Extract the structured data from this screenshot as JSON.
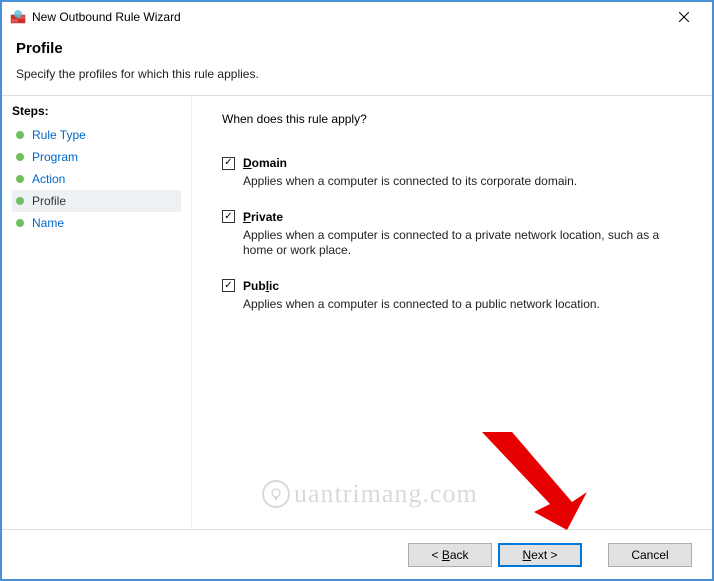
{
  "titlebar": {
    "title": "New Outbound Rule Wizard"
  },
  "header": {
    "title": "Profile",
    "subtitle": "Specify the profiles for which this rule applies."
  },
  "sidebar": {
    "label": "Steps:",
    "items": [
      {
        "label": "Rule Type",
        "current": false
      },
      {
        "label": "Program",
        "current": false
      },
      {
        "label": "Action",
        "current": false
      },
      {
        "label": "Profile",
        "current": true
      },
      {
        "label": "Name",
        "current": false
      }
    ]
  },
  "main": {
    "prompt": "When does this rule apply?",
    "options": [
      {
        "checked": true,
        "accel": "D",
        "rest": "omain",
        "desc": "Applies when a computer is connected to its corporate domain."
      },
      {
        "checked": true,
        "accel": "P",
        "rest": "rivate",
        "desc": "Applies when a computer is connected to a private network location, such as a home or work place."
      },
      {
        "checked": true,
        "accel": "P",
        "rest_pre": "ub",
        "accel2": "l",
        "rest": "ic",
        "desc": "Applies when a computer is connected to a public network location."
      }
    ]
  },
  "footer": {
    "back_accel": "B",
    "back_rest": "ack",
    "back_prefix": "< ",
    "next_accel": "N",
    "next_rest": "ext >",
    "cancel": "Cancel"
  },
  "watermark": "uantrimang.com"
}
